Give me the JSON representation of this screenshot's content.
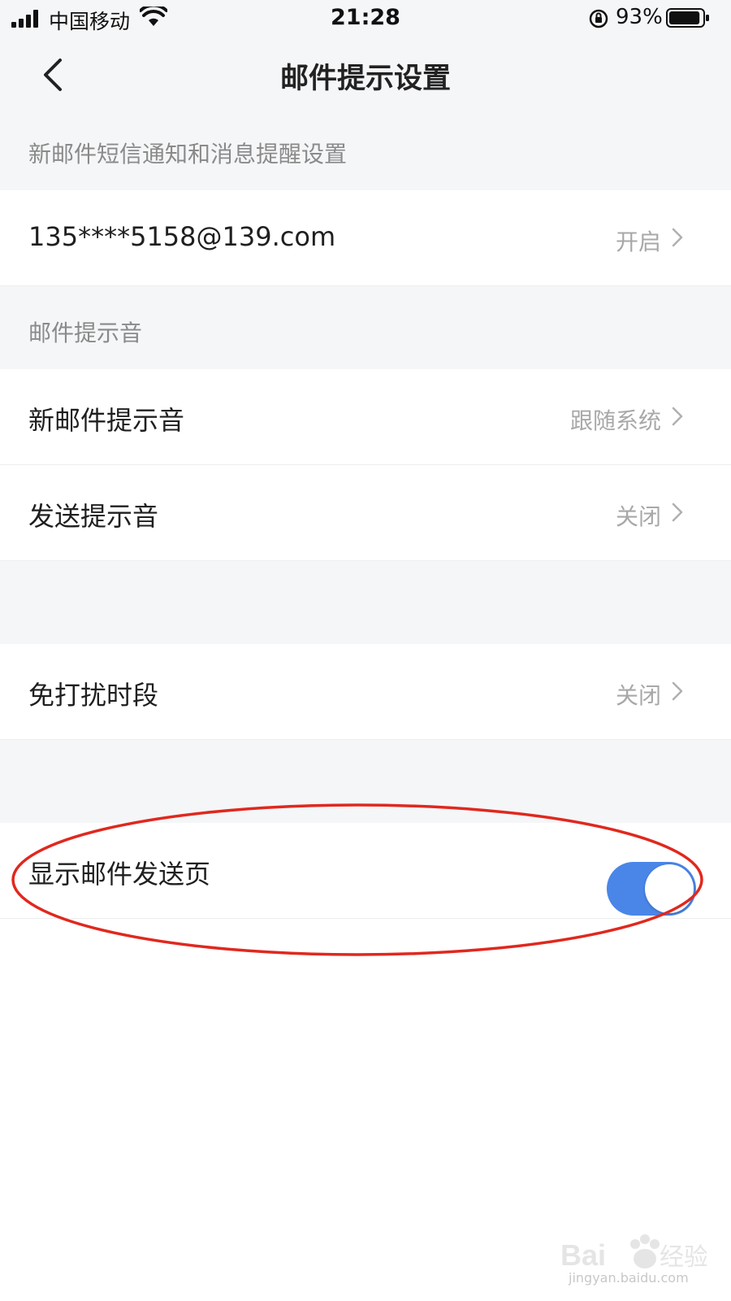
{
  "status_bar": {
    "carrier": "中国移动",
    "time": "21:28",
    "battery_percent": "93%",
    "battery_level": 0.93
  },
  "nav": {
    "title": "邮件提示设置",
    "back_icon": "chevron-left-icon"
  },
  "sections": [
    {
      "header": "新邮件短信通知和消息提醒设置"
    },
    {
      "header": "邮件提示音"
    }
  ],
  "rows": {
    "email_account": {
      "title": "135****5158@139.com",
      "value": "开启"
    },
    "new_mail_sound": {
      "title": "新邮件提示音",
      "value": "跟随系统"
    },
    "send_sound": {
      "title": "发送提示音",
      "value": "关闭"
    },
    "do_not_disturb": {
      "title": "免打扰时段",
      "value": "关闭"
    },
    "show_send_page": {
      "title": "显示邮件发送页",
      "toggle_on": true
    }
  },
  "colors": {
    "accent": "#4a86e8",
    "annotation": "#e0281e",
    "background_gray": "#f5f6f8"
  },
  "watermark": {
    "brand": "Baidu经验",
    "url": "jingyan.baidu.com"
  }
}
